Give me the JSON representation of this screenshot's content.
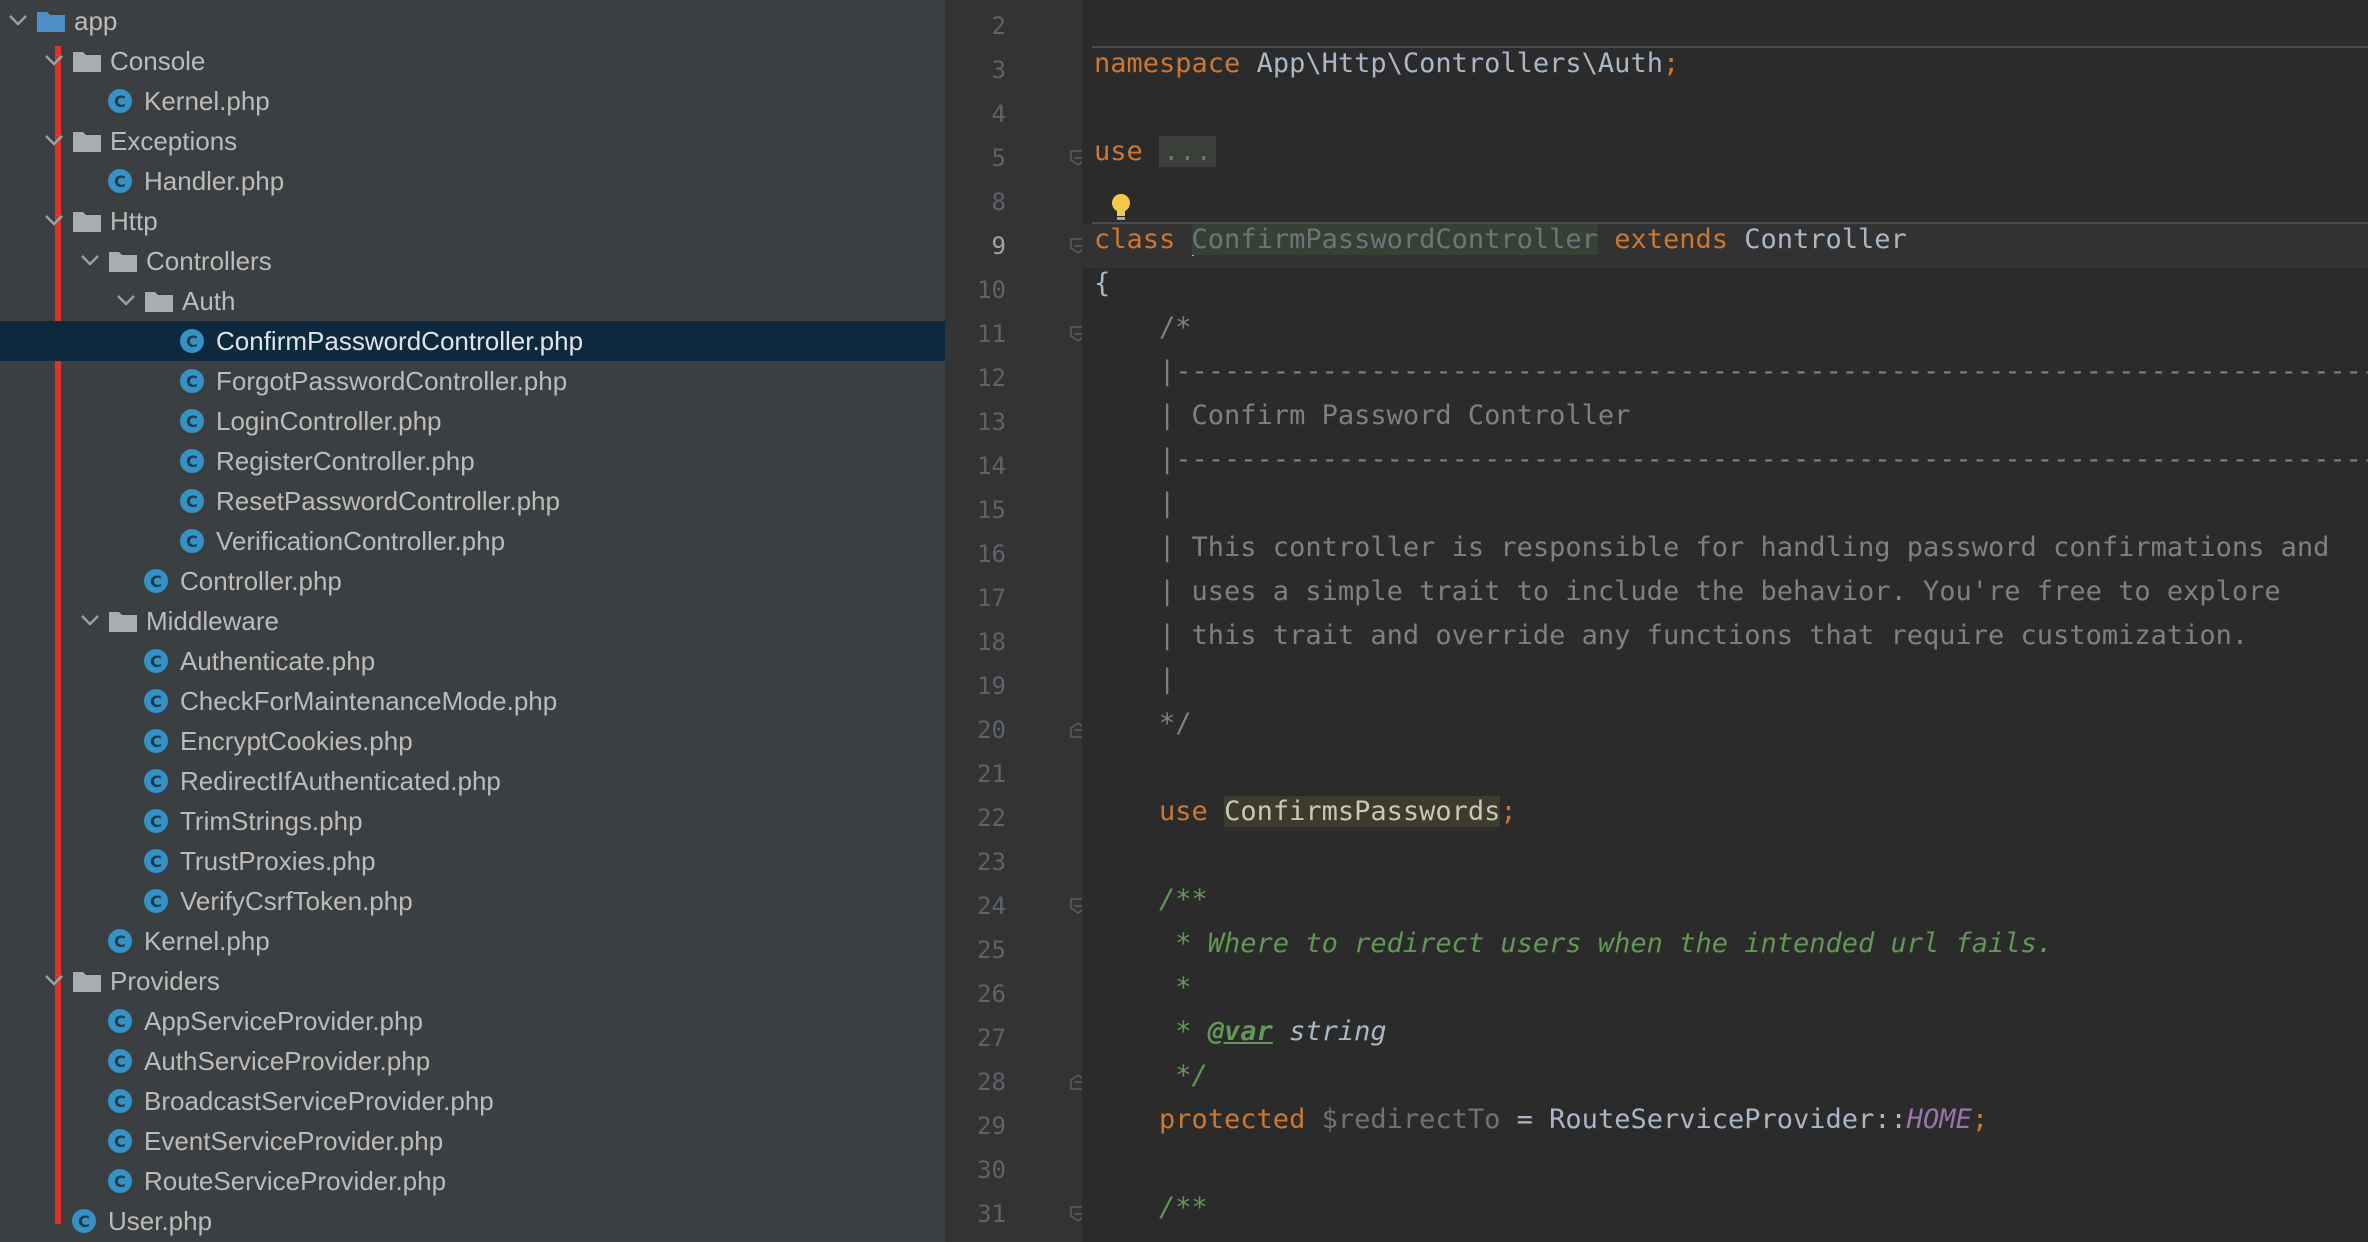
{
  "project_tree": {
    "items": [
      {
        "label": "app",
        "kind": "folder",
        "expanded": true,
        "depth": 0
      },
      {
        "label": "Console",
        "kind": "folder",
        "expanded": true,
        "depth": 1
      },
      {
        "label": "Kernel.php",
        "kind": "class-file",
        "depth": 2
      },
      {
        "label": "Exceptions",
        "kind": "folder",
        "expanded": true,
        "depth": 1
      },
      {
        "label": "Handler.php",
        "kind": "class-file",
        "depth": 2
      },
      {
        "label": "Http",
        "kind": "folder",
        "expanded": true,
        "depth": 1
      },
      {
        "label": "Controllers",
        "kind": "folder",
        "expanded": true,
        "depth": 2
      },
      {
        "label": "Auth",
        "kind": "folder",
        "expanded": true,
        "depth": 3
      },
      {
        "label": "ConfirmPasswordController.php",
        "kind": "class-file",
        "depth": 4,
        "selected": true
      },
      {
        "label": "ForgotPasswordController.php",
        "kind": "class-file",
        "depth": 4
      },
      {
        "label": "LoginController.php",
        "kind": "class-file",
        "depth": 4
      },
      {
        "label": "RegisterController.php",
        "kind": "class-file",
        "depth": 4
      },
      {
        "label": "ResetPasswordController.php",
        "kind": "class-file",
        "depth": 4
      },
      {
        "label": "VerificationController.php",
        "kind": "class-file",
        "depth": 4
      },
      {
        "label": "Controller.php",
        "kind": "class-file",
        "depth": 3
      },
      {
        "label": "Middleware",
        "kind": "folder",
        "expanded": true,
        "depth": 2
      },
      {
        "label": "Authenticate.php",
        "kind": "class-file",
        "depth": 3
      },
      {
        "label": "CheckForMaintenanceMode.php",
        "kind": "class-file",
        "depth": 3
      },
      {
        "label": "EncryptCookies.php",
        "kind": "class-file",
        "depth": 3
      },
      {
        "label": "RedirectIfAuthenticated.php",
        "kind": "class-file",
        "depth": 3
      },
      {
        "label": "TrimStrings.php",
        "kind": "class-file",
        "depth": 3
      },
      {
        "label": "TrustProxies.php",
        "kind": "class-file",
        "depth": 3
      },
      {
        "label": "VerifyCsrfToken.php",
        "kind": "class-file",
        "depth": 3
      },
      {
        "label": "Kernel.php",
        "kind": "class-file",
        "depth": 2
      },
      {
        "label": "Providers",
        "kind": "folder",
        "expanded": true,
        "depth": 1
      },
      {
        "label": "AppServiceProvider.php",
        "kind": "class-file",
        "depth": 2
      },
      {
        "label": "AuthServiceProvider.php",
        "kind": "class-file",
        "depth": 2
      },
      {
        "label": "BroadcastServiceProvider.php",
        "kind": "class-file",
        "depth": 2
      },
      {
        "label": "EventServiceProvider.php",
        "kind": "class-file",
        "depth": 2
      },
      {
        "label": "RouteServiceProvider.php",
        "kind": "class-file",
        "depth": 2
      },
      {
        "label": "User.php",
        "kind": "class-file",
        "depth": 1
      }
    ],
    "class_icon_letter": "C",
    "guide_color": "#e0312a",
    "selection_color": "#0d293e"
  },
  "editor": {
    "current_line": "9",
    "lines": [
      {
        "no": "2",
        "fold": false,
        "tokens": []
      },
      {
        "no": "3",
        "fold": false,
        "tokens": [
          {
            "t": "namespace",
            "c": "kw"
          },
          {
            "t": " App\\Http\\Controllers\\Auth",
            "c": "ns"
          },
          {
            "t": ";",
            "c": "kw"
          }
        ]
      },
      {
        "no": "4",
        "fold": false,
        "tokens": []
      },
      {
        "no": "5",
        "fold": "start",
        "tokens": [
          {
            "t": "use",
            "c": "kw"
          },
          {
            "t": " ",
            "c": "ns"
          },
          {
            "t": "...",
            "c": "fold-box"
          }
        ]
      },
      {
        "no": "8",
        "fold": false,
        "tokens": []
      },
      {
        "no": "9",
        "fold": "start",
        "tokens": [
          {
            "t": "class",
            "c": "kw"
          },
          {
            "t": " ",
            "c": "ns"
          },
          {
            "t": "",
            "c": "caret"
          },
          {
            "t": "ConfirmPasswordController",
            "c": "hl-class"
          },
          {
            "t": " ",
            "c": "ns"
          },
          {
            "t": "extends",
            "c": "kw"
          },
          {
            "t": " Controller",
            "c": "ns"
          }
        ]
      },
      {
        "no": "10",
        "fold": false,
        "tokens": [
          {
            "t": "{",
            "c": "ns"
          }
        ]
      },
      {
        "no": "11",
        "fold": "start",
        "tokens": [
          {
            "t": "    /*",
            "c": "cm"
          }
        ]
      },
      {
        "no": "12",
        "fold": false,
        "tokens": [
          {
            "t": "    |--------------------------------------------------------------------------",
            "c": "cm"
          }
        ]
      },
      {
        "no": "13",
        "fold": false,
        "tokens": [
          {
            "t": "    | Confirm Password Controller",
            "c": "cm"
          }
        ]
      },
      {
        "no": "14",
        "fold": false,
        "tokens": [
          {
            "t": "    |--------------------------------------------------------------------------",
            "c": "cm"
          }
        ]
      },
      {
        "no": "15",
        "fold": false,
        "tokens": [
          {
            "t": "    |",
            "c": "cm"
          }
        ]
      },
      {
        "no": "16",
        "fold": false,
        "tokens": [
          {
            "t": "    | This controller is responsible for handling password confirmations and",
            "c": "cm"
          }
        ]
      },
      {
        "no": "17",
        "fold": false,
        "tokens": [
          {
            "t": "    | uses a simple trait to include the behavior. You're free to explore",
            "c": "cm"
          }
        ]
      },
      {
        "no": "18",
        "fold": false,
        "tokens": [
          {
            "t": "    | this trait and override any functions that require customization.",
            "c": "cm"
          }
        ]
      },
      {
        "no": "19",
        "fold": false,
        "tokens": [
          {
            "t": "    |",
            "c": "cm"
          }
        ]
      },
      {
        "no": "20",
        "fold": "end",
        "tokens": [
          {
            "t": "    */",
            "c": "cm"
          }
        ]
      },
      {
        "no": "21",
        "fold": false,
        "tokens": []
      },
      {
        "no": "22",
        "fold": false,
        "tokens": [
          {
            "t": "    use",
            "c": "kw"
          },
          {
            "t": " ",
            "c": "ns"
          },
          {
            "t": "ConfirmsPasswords",
            "c": "hl-trait"
          },
          {
            "t": ";",
            "c": "kw"
          }
        ]
      },
      {
        "no": "23",
        "fold": false,
        "tokens": []
      },
      {
        "no": "24",
        "fold": "start",
        "tokens": [
          {
            "t": "    /**",
            "c": "doc"
          }
        ]
      },
      {
        "no": "25",
        "fold": false,
        "tokens": [
          {
            "t": "     * Where to redirect users when the intended url fails.",
            "c": "doc"
          }
        ]
      },
      {
        "no": "26",
        "fold": false,
        "tokens": [
          {
            "t": "     *",
            "c": "doc"
          }
        ]
      },
      {
        "no": "27",
        "fold": false,
        "tokens": [
          {
            "t": "     * ",
            "c": "doc"
          },
          {
            "t": "@var",
            "c": "doc-tag"
          },
          {
            "t": " string",
            "c": "doc-type"
          }
        ]
      },
      {
        "no": "28",
        "fold": "end",
        "tokens": [
          {
            "t": "     */",
            "c": "doc"
          }
        ]
      },
      {
        "no": "29",
        "fold": false,
        "tokens": [
          {
            "t": "    protected",
            "c": "kw"
          },
          {
            "t": " ",
            "c": "ns"
          },
          {
            "t": "$redirectTo",
            "c": "unused"
          },
          {
            "t": " = RouteServiceProvider::",
            "c": "ns"
          },
          {
            "t": "HOME",
            "c": "const"
          },
          {
            "t": ";",
            "c": "kw"
          }
        ]
      },
      {
        "no": "30",
        "fold": false,
        "tokens": []
      },
      {
        "no": "31",
        "fold": "start",
        "tokens": [
          {
            "t": "    /**",
            "c": "doc"
          }
        ]
      }
    ]
  },
  "colors": {
    "tree_bg": "#3c3f41",
    "editor_bg": "#2b2b2b",
    "gutter_bg": "#313335",
    "keyword": "#cc7832",
    "comment": "#808080",
    "doc_comment": "#629755",
    "class_icon": "#3592c4"
  }
}
